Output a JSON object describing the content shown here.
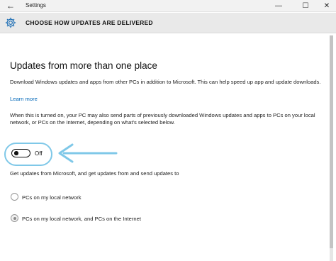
{
  "window": {
    "title": "Settings",
    "back_glyph": "←",
    "minimize_glyph": "—",
    "maximize_glyph": "☐",
    "close_glyph": "✕"
  },
  "header": {
    "icon": "gear-icon",
    "title": "CHOOSE HOW UPDATES ARE DELIVERED"
  },
  "main": {
    "section_title": "Updates from more than one place",
    "description": "Download Windows updates and apps from other PCs in addition to Microsoft. This can help speed up app and update downloads.",
    "learn_more": "Learn more",
    "toggle_description": "When this is turned on, your PC may also send parts of previously downloaded Windows updates and apps to PCs on your local network, or PCs on the Internet, depending on what's selected below.",
    "toggle": {
      "state": "off",
      "label": "Off"
    },
    "source_prompt": "Get updates from Microsoft, and get updates from and send updates to",
    "options": [
      {
        "label": "PCs on my local network",
        "selected": false
      },
      {
        "label": "PCs on my local network, and PCs on the Internet",
        "selected": true
      }
    ]
  },
  "colors": {
    "accent_link": "#0067b8",
    "annotation": "#7fc8e8",
    "header_bg": "#e9e9e9",
    "titlebar_bg": "#f2f2f2"
  }
}
